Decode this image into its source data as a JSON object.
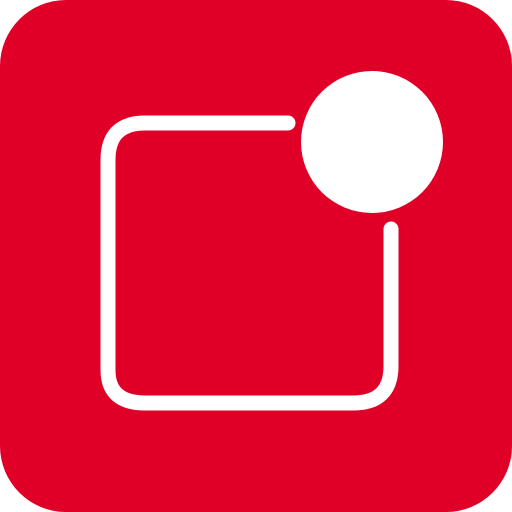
{
  "app_icon": {
    "name": "notification-icon",
    "colors": {
      "background": "#E00027",
      "glyph": "#FFFFFF"
    }
  }
}
